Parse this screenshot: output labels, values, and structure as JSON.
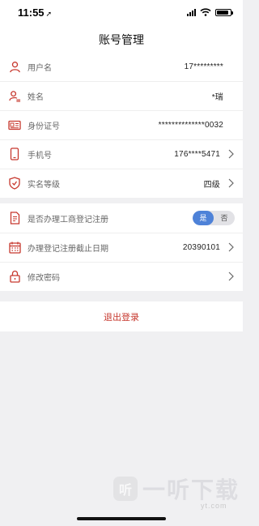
{
  "status": {
    "time": "11:55",
    "location_arrow": "➚"
  },
  "nav": {
    "title": "账号管理"
  },
  "account_rows": [
    {
      "icon": "user-icon",
      "label": "用户名",
      "value": "17*********"
    },
    {
      "icon": "person-edit-icon",
      "label": "姓名",
      "value": "*瑞"
    },
    {
      "icon": "id-card-icon",
      "label": "身份证号",
      "value": "**************0032"
    },
    {
      "icon": "phone-icon",
      "label": "手机号",
      "value": "176****5471"
    },
    {
      "icon": "shield-icon",
      "label": "实名等级",
      "value": "四级"
    }
  ],
  "registration": {
    "business_registered": {
      "icon": "document-icon",
      "label": "是否办理工商登记注册",
      "yes": "是",
      "no": "否",
      "selected": "是"
    },
    "expiry": {
      "icon": "calendar-icon",
      "label": "办理登记注册截止日期",
      "value": "20390101"
    },
    "password": {
      "icon": "lock-icon",
      "label": "修改密码"
    }
  },
  "logout": {
    "label": "退出登录"
  },
  "colors": {
    "accent_red": "#c7382e",
    "toggle_blue": "#4e82d8"
  },
  "watermark": {
    "logo_char": "听",
    "text": "一听下载",
    "sub": "yt.com"
  }
}
